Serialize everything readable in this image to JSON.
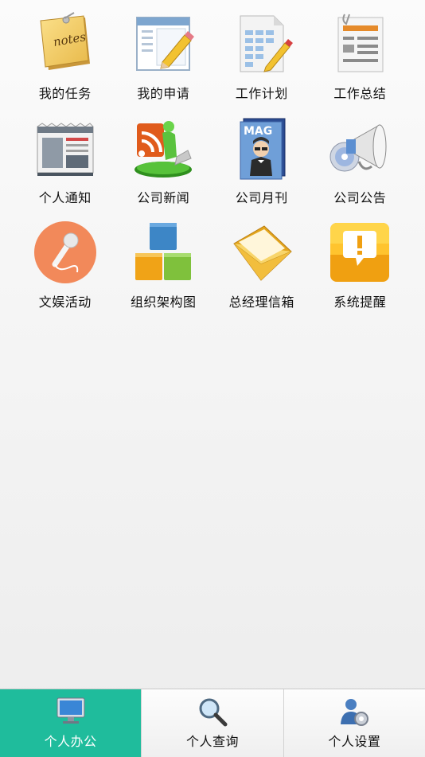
{
  "apps": [
    {
      "label": "我的任务",
      "icon": "notes-icon"
    },
    {
      "label": "我的申请",
      "icon": "form-pencil-icon"
    },
    {
      "label": "工作计划",
      "icon": "spreadsheet-pencil-icon"
    },
    {
      "label": "工作总结",
      "icon": "report-document-icon"
    },
    {
      "label": "个人通知",
      "icon": "newspaper-icon"
    },
    {
      "label": "公司新闻",
      "icon": "rss-reader-icon"
    },
    {
      "label": "公司月刊",
      "icon": "magazine-icon"
    },
    {
      "label": "公司公告",
      "icon": "megaphone-icon"
    },
    {
      "label": "文娱活动",
      "icon": "microphone-icon"
    },
    {
      "label": "组织架构图",
      "icon": "org-blocks-icon"
    },
    {
      "label": "总经理信箱",
      "icon": "mail-envelope-icon"
    },
    {
      "label": "系统提醒",
      "icon": "alert-icon"
    }
  ],
  "icon_texts": {
    "notes": "notes",
    "magazine": "MAG"
  },
  "tabbar": {
    "active_index": 0,
    "active_color": "#1fbc9c",
    "tabs": [
      {
        "label": "个人办公",
        "icon": "monitor-icon"
      },
      {
        "label": "个人查询",
        "icon": "magnifier-icon"
      },
      {
        "label": "个人设置",
        "icon": "user-gear-icon"
      }
    ]
  }
}
